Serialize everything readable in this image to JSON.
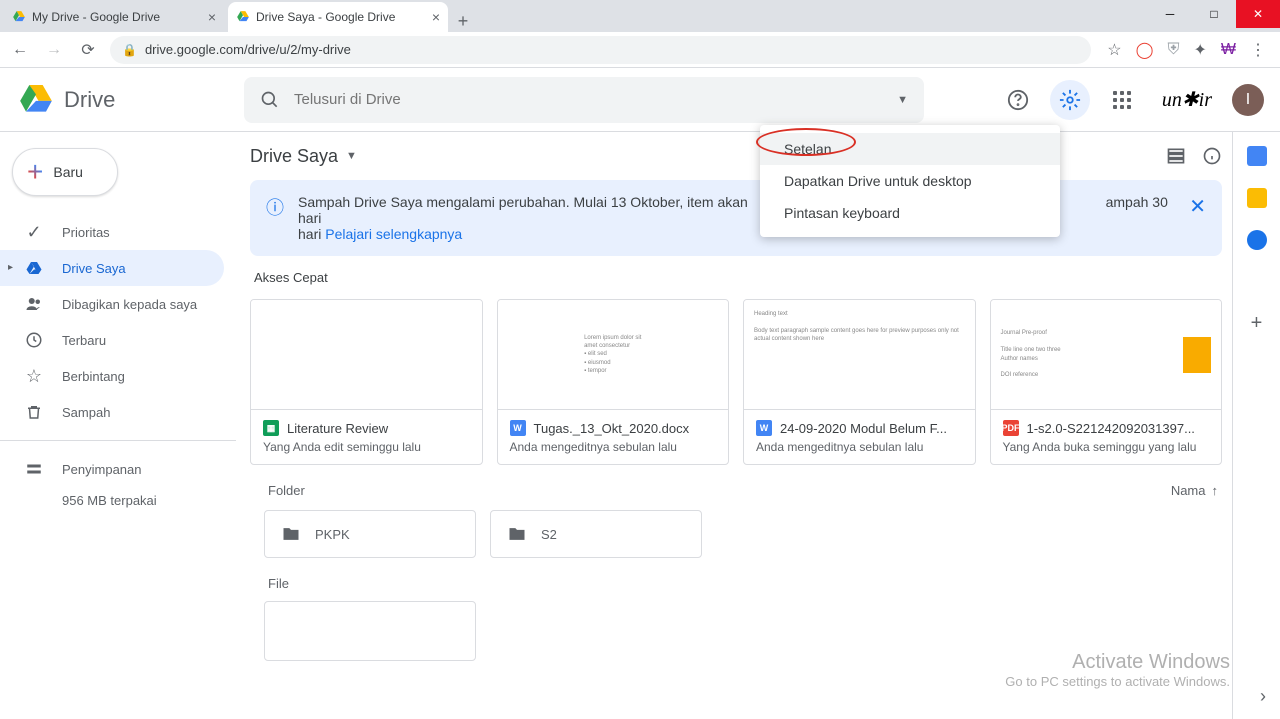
{
  "browser": {
    "tabs": [
      {
        "title": "My Drive - Google Drive"
      },
      {
        "title": "Drive Saya - Google Drive"
      }
    ],
    "url": "drive.google.com/drive/u/2/my-drive"
  },
  "drive": {
    "logo_text": "Drive",
    "search_placeholder": "Telusuri di Drive",
    "org_name": "un✱ir",
    "avatar_letter": "I",
    "new_button": "Baru",
    "sidebar": {
      "items": [
        {
          "label": "Prioritas"
        },
        {
          "label": "Drive Saya"
        },
        {
          "label": "Dibagikan kepada saya"
        },
        {
          "label": "Terbaru"
        },
        {
          "label": "Berbintang"
        },
        {
          "label": "Sampah"
        }
      ],
      "storage_label": "Penyimpanan",
      "storage_used": "956 MB terpakai"
    },
    "location": "Drive Saya",
    "banner": {
      "bold": "Sampah Drive Saya mengalami perubahan.",
      "text1": " Mulai 13 Oktober, item akan",
      "text2": "ampah 30 hari ",
      "link": "Pelajari selengkapnya"
    },
    "quick_access_label": "Akses Cepat",
    "quick_access": [
      {
        "name": "Literature Review",
        "sub": "Yang Anda edit seminggu lalu",
        "type": "sheets"
      },
      {
        "name": "Tugas._13_Okt_2020.docx",
        "sub": "Anda mengeditnya sebulan lalu",
        "type": "docs"
      },
      {
        "name": "24-09-2020 Modul Belum F...",
        "sub": "Anda mengeditnya sebulan lalu",
        "type": "docs"
      },
      {
        "name": "1-s2.0-S221242092031397...",
        "sub": "Yang Anda buka seminggu yang lalu",
        "type": "pdf"
      }
    ],
    "folder_label": "Folder",
    "sort_label": "Nama",
    "folders": [
      {
        "name": "PKPK"
      },
      {
        "name": "S2"
      }
    ],
    "file_label": "File"
  },
  "dropdown": {
    "items": [
      {
        "label": "Setelan"
      },
      {
        "label": "Dapatkan Drive untuk desktop"
      },
      {
        "label": "Pintasan keyboard"
      }
    ]
  },
  "windows": {
    "line1": "Activate Windows",
    "line2": "Go to PC settings to activate Windows."
  }
}
